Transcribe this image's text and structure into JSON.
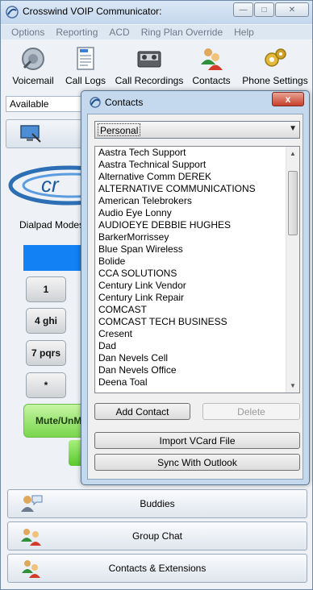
{
  "window": {
    "title": "Crosswind VOIP Communicator:"
  },
  "menu": [
    "Options",
    "Reporting",
    "ACD",
    "Ring Plan Override",
    "Help"
  ],
  "toolbar": [
    {
      "label": "Voicemail",
      "icon": "voicemail-icon"
    },
    {
      "label": "Call Logs",
      "icon": "call-logs-icon"
    },
    {
      "label": "Call Recordings",
      "icon": "call-recordings-icon"
    },
    {
      "label": "Contacts",
      "icon": "contacts-icon"
    },
    {
      "label": "Phone Settings",
      "icon": "phone-settings-icon"
    }
  ],
  "status": {
    "value": "Available"
  },
  "dialpad": {
    "label": "Dialpad Modes",
    "keys": [
      "1",
      "4 ghi",
      "7 pqrs",
      "*"
    ],
    "mute_label": "Mute/UnM"
  },
  "bottom_tabs": [
    "Buddies",
    "Group Chat",
    "Contacts & Extensions"
  ],
  "contacts_dialog": {
    "title": "Contacts",
    "close_label": "x",
    "group_selected": "Personal",
    "contacts": [
      "Aastra Tech Support",
      "Aastra Technical Support",
      "Alternative Comm DEREK",
      "ALTERNATIVE COMMUNICATIONS",
      "American Telebrokers",
      "Audio Eye Lonny",
      "AUDIOEYE DEBBIE HUGHES",
      "BarkerMorrissey",
      "Blue Span Wireless",
      "Bolide",
      "CCA SOLUTIONS",
      "Century  Link Vendor",
      "Century Link Repair",
      "COMCAST",
      "COMCAST TECH BUSINESS",
      "Cresent",
      "Dad",
      "Dan Nevels Cell",
      "Dan Nevels Office",
      "Deena Toal"
    ],
    "add_label": "Add Contact",
    "delete_label": "Delete",
    "import_label": "Import VCard File",
    "sync_label": "Sync With Outlook"
  },
  "colors": {
    "accent": "#1181f4",
    "mute_green": "#7ad64d",
    "close_red": "#c6412b"
  }
}
